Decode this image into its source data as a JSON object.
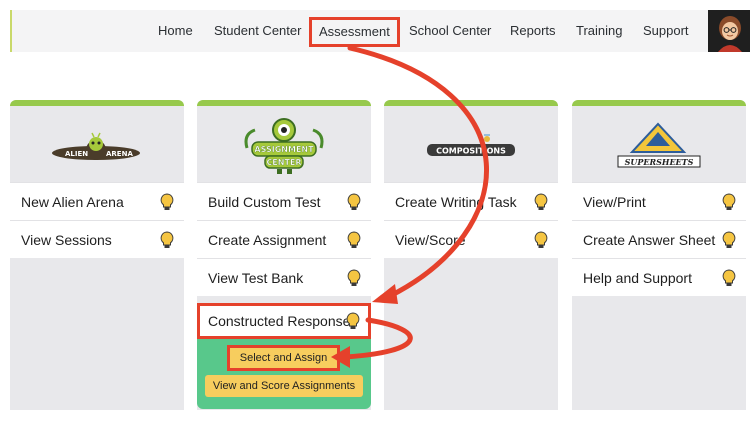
{
  "nav": {
    "items": [
      "Home",
      "Student Center",
      "Assessment",
      "School Center",
      "Reports",
      "Training",
      "Support"
    ],
    "active": "Assessment"
  },
  "cards": [
    {
      "logo_text": "ALIEN ARENA",
      "items": [
        "New Alien Arena",
        "View Sessions"
      ]
    },
    {
      "logo_text": "ASSIGNMENT CENTER",
      "items": [
        "Build Custom Test",
        "Create Assignment",
        "View Test Bank"
      ]
    },
    {
      "logo_text": "COMPOSITIONS",
      "items": [
        "Create Writing Task",
        "View/Score"
      ]
    },
    {
      "logo_text": "SUPERSHEETS",
      "items": [
        "View/Print",
        "Create Answer Sheet",
        "Help and Support"
      ]
    }
  ],
  "constructed_response": {
    "label": "Constructed Response",
    "select_assign": "Select and Assign",
    "view_score": "View and Score Assignments"
  },
  "colors": {
    "highlight": "#e5412b",
    "card_accent": "#97c94c",
    "panel": "#58c88b",
    "button": "#f7cd5e",
    "bulb": "#f5c542"
  },
  "icons": {
    "hint": "lightbulb-icon",
    "profile": "avatar"
  }
}
